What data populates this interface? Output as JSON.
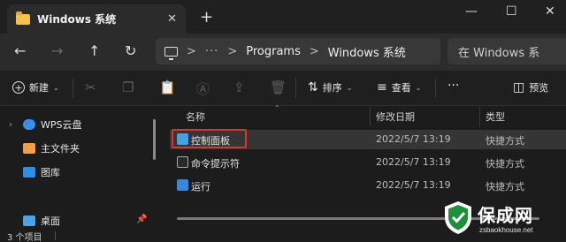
{
  "window": {
    "tab_title": "Windows 系统",
    "tab_close": "✕",
    "new_tab": "+",
    "minimize": "—",
    "maximize": "☐",
    "close": "✕"
  },
  "nav": {
    "back": "←",
    "forward": "→",
    "up": "↑",
    "refresh": "↻"
  },
  "address": {
    "ellipsis": "···",
    "crumbs": [
      "Programs",
      "Windows 系统"
    ],
    "separator": ">"
  },
  "search": {
    "placeholder": "在 Windows 系"
  },
  "commands": {
    "new_label": "新建",
    "sort_label": "排序",
    "view_label": "查看",
    "more": "···",
    "preview_label": "预览"
  },
  "sidebar": {
    "items": [
      {
        "label": "WPS云盘",
        "icon": "cloud-icon",
        "color": "#3b8ee8"
      },
      {
        "label": "主文件夹",
        "icon": "home-icon",
        "color": "#f0a04b"
      },
      {
        "label": "图库",
        "icon": "gallery-icon",
        "color": "#2f8fe0"
      },
      {
        "label": "桌面",
        "icon": "desktop-icon",
        "color": "#4aa3e8"
      }
    ],
    "pin": "📌"
  },
  "filelist": {
    "columns": [
      "名称",
      "修改日期",
      "类型"
    ],
    "rows": [
      {
        "name": "控制面板",
        "date": "2022/5/7 13:19",
        "type": "快捷方式",
        "icon": "control-panel-icon",
        "selected": true
      },
      {
        "name": "命令提示符",
        "date": "2022/5/7 13:19",
        "type": "快捷方式",
        "icon": "cmd-icon",
        "selected": false
      },
      {
        "name": "运行",
        "date": "2022/5/7 13:19",
        "type": "快捷方式",
        "icon": "run-icon",
        "selected": false
      }
    ]
  },
  "status": {
    "count": "3 个项目"
  },
  "watermark": {
    "main": "保成网",
    "url": "zsbaokhouse.net"
  },
  "colors": {
    "accent_selection_box": "#e0322b",
    "folder": "#f4c24f"
  }
}
